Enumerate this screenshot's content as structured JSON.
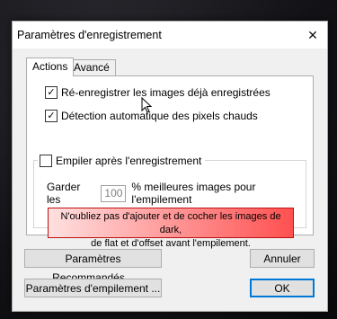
{
  "window": {
    "title": "Paramètres d'enregistrement",
    "close_glyph": "✕"
  },
  "tabs": [
    {
      "label": "Actions",
      "active": true
    },
    {
      "label": "Avancé",
      "active": false
    }
  ],
  "options": {
    "reregister": {
      "label": "Ré-enregistrer les images déjà enregistrées",
      "checked": true
    },
    "hot_pixels": {
      "label": "Détection automatique des pixels chauds",
      "checked": true
    },
    "stack_after": {
      "label": "Empiler après l'enregistrement",
      "checked": false
    }
  },
  "stacking": {
    "keep_prefix": "Garder les",
    "keep_value": "100",
    "keep_suffix": "% meilleures images pour l'empilement"
  },
  "warning": {
    "line1": "N'oubliez pas d'ajouter et de cocher les images de dark,",
    "line2": "de flat et d'offset avant l'empilement."
  },
  "buttons": {
    "recommended": "Paramètres Recommandés...",
    "cancel": "Annuler",
    "stacking_params": "Paramètres d'empilement ...",
    "ok": "OK"
  },
  "colors": {
    "accent": "#0078d7",
    "warning_end": "#ff5050",
    "warning_border": "#c01010"
  },
  "icons": {
    "checkbox_checked": "✓"
  }
}
